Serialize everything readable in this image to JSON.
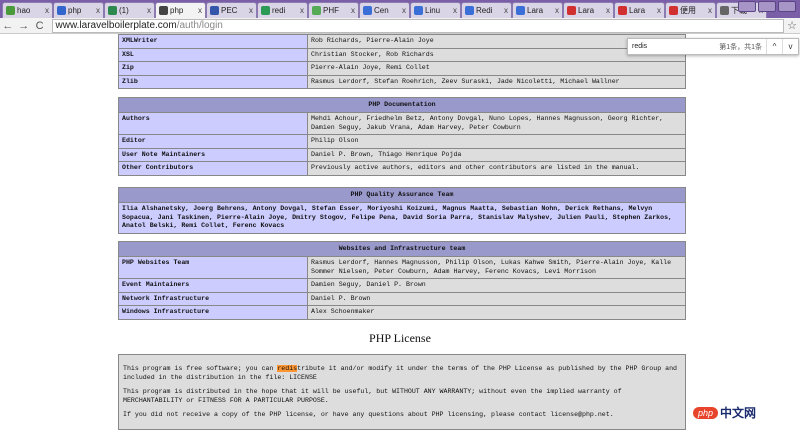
{
  "browser": {
    "tabs": [
      "hao",
      "php",
      "(1)",
      "php",
      "PEC",
      "redi",
      "PHF",
      "Cen",
      "Linu",
      "Redi",
      "Lara",
      "Lara",
      "Lara",
      "便用",
      "下载"
    ],
    "active_tab": 3,
    "tab_colors": [
      "#4a9a3a",
      "#3366cc",
      "#2d8a4e",
      "#444444",
      "#3355aa",
      "#2a9a55",
      "#55aa55",
      "#3a6fd8",
      "#3a6fd8",
      "#3a6fd8",
      "#3a6fd8",
      "#d03030",
      "#d03030",
      "#d03030",
      "#666666"
    ],
    "url_host": "www.laravelboilerplate.com",
    "url_path": "/auth/login"
  },
  "find_bar": {
    "query": "redis",
    "count": "第1条，共1条",
    "prev": "^",
    "next": "v"
  },
  "top_rows": [
    [
      "XMLWriter",
      "Rob Richards, Pierre-Alain Joye"
    ],
    [
      "XSL",
      "Christian Stocker, Rob Richards"
    ],
    [
      "Zip",
      "Pierre-Alain Joye, Remi Collet"
    ],
    [
      "Zlib",
      "Rasmus Lerdorf, Stefan Roehrich, Zeev Suraski, Jade Nicoletti, Michael Wallner"
    ]
  ],
  "documentation": {
    "title": "PHP Documentation",
    "rows": [
      [
        "Authors",
        "Mehdi Achour, Friedhelm Betz, Antony Dovgal, Nuno Lopes, Hannes Magnusson, Georg Richter, Damien Seguy, Jakub Vrana, Adam Harvey, Peter Cowburn"
      ],
      [
        "Editor",
        "Philip Olson"
      ],
      [
        "User Note Maintainers",
        "Daniel P. Brown, Thiago Henrique Pojda"
      ],
      [
        "Other Contributors",
        "Previously active authors, editors and other contributors are listed in the manual."
      ]
    ]
  },
  "qa": {
    "title": "PHP Quality Assurance Team",
    "members": "Ilia Alshanetsky, Joerg Behrens, Antony Dovgal, Stefan Esser, Moriyoshi Koizumi, Magnus Maatta, Sebastian Nohn, Derick Rethans, Melvyn Sopacua, Jani Taskinen, Pierre-Alain Joye, Dmitry Stogov, Felipe Pena, David Soria Parra, Stanislav Malyshev, Julien Pauli, Stephen Zarkos, Anatol Belski, Remi Collet, Ferenc Kovacs"
  },
  "websites": {
    "title": "Websites and Infrastructure team",
    "rows": [
      [
        "PHP Websites Team",
        "Rasmus Lerdorf, Hannes Magnusson, Philip Olson, Lukas Kahwe Smith, Pierre-Alain Joye, Kalle Sommer Nielsen, Peter Cowburn, Adam Harvey, Ferenc Kovacs, Levi Morrison"
      ],
      [
        "Event Maintainers",
        "Damien Seguy, Daniel P. Brown"
      ],
      [
        "Network Infrastructure",
        "Daniel P. Brown"
      ],
      [
        "Windows Infrastructure",
        "Alex Schoenmaker"
      ]
    ]
  },
  "license": {
    "heading": "PHP License",
    "p1_before": "This program is free software; you can ",
    "p1_match": "redis",
    "p1_after": "tribute it and/or modify it under the terms of the PHP License as published by the PHP Group and included in the distribution in the file: LICENSE",
    "p2": "This program is distributed in the hope that it will be useful, but WITHOUT ANY WARRANTY; without even the implied warranty of MERCHANTABILITY or FITNESS FOR A PARTICULAR PURPOSE.",
    "p3": "If you did not receive a copy of the PHP license, or have any questions about PHP licensing, please contact license@php.net."
  },
  "watermark": {
    "badge": "php",
    "text": "中文网"
  }
}
